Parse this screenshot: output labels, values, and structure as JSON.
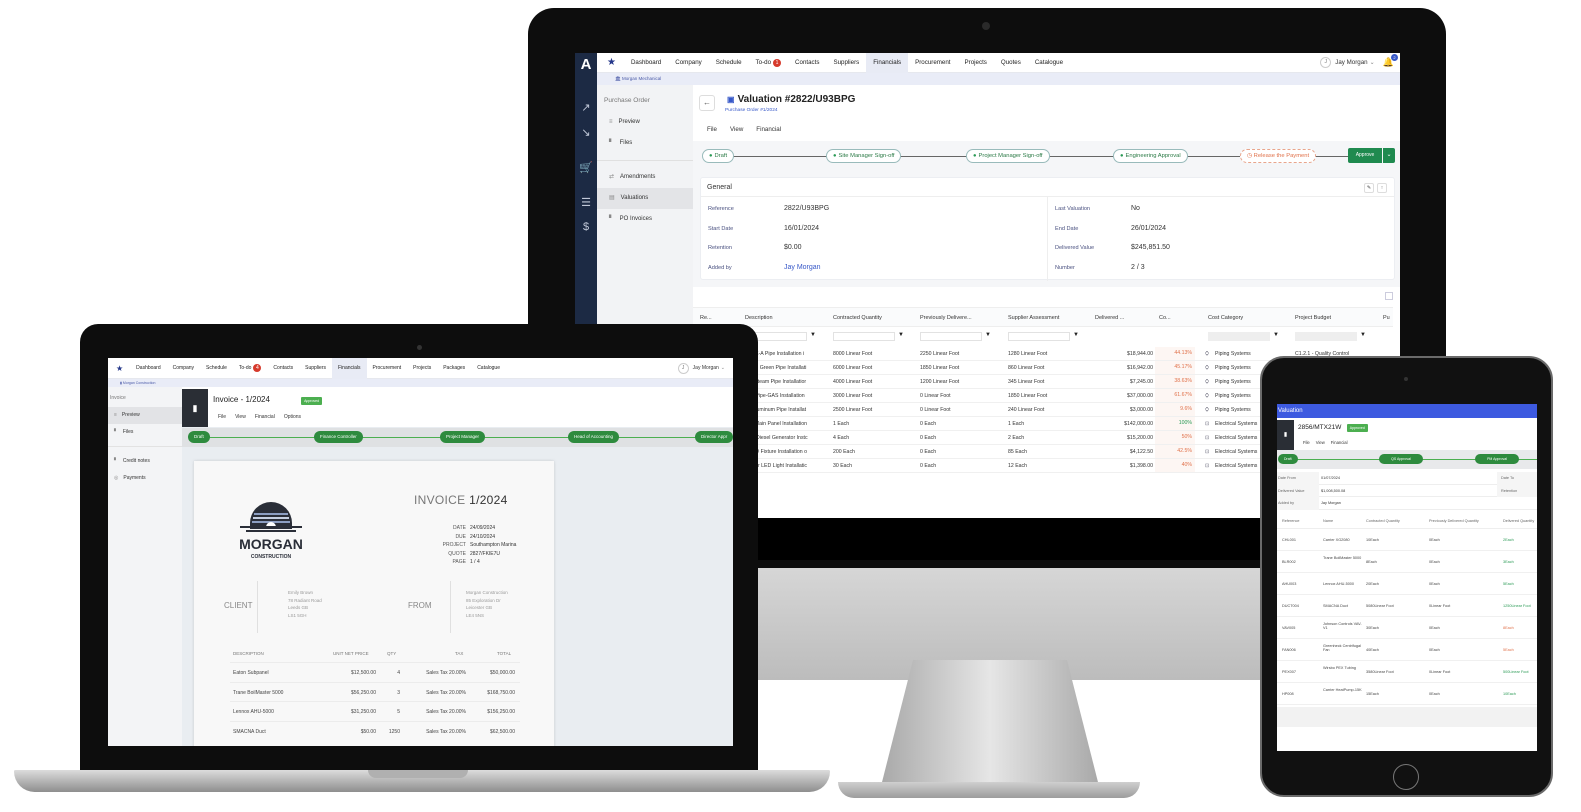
{
  "desktop": {
    "nav": {
      "logo": "A",
      "items": [
        "Dashboard",
        "Company",
        "Schedule",
        "To-do",
        "Contacts",
        "Suppliers",
        "Financials",
        "Procurement",
        "Projects",
        "Quotes",
        "Catalogue"
      ],
      "active": "Financials",
      "todo_badge": "1",
      "user_initial": "J",
      "user_name": "Jay Morgan",
      "notification_badge": "2"
    },
    "org": "Morgan Mechanical",
    "sidebar": {
      "title": "Purchase Order",
      "items": [
        {
          "label": "Preview",
          "icon": "list-icon"
        },
        {
          "label": "Files",
          "icon": "file-icon"
        },
        {
          "label": "Amendments",
          "icon": "swap-icon"
        },
        {
          "label": "Valuations",
          "icon": "table-icon",
          "active": true
        },
        {
          "label": "PO Invoices",
          "icon": "invoice-icon"
        }
      ]
    },
    "header": {
      "title": "Valuation #2822/U93BPG",
      "subtitle": "Purchase Order #1/2024",
      "menus": [
        "File",
        "View",
        "Financial"
      ]
    },
    "workflow": {
      "steps": [
        {
          "label": "Draft",
          "state": "done"
        },
        {
          "label": "Site Manager Sign-off",
          "state": "done"
        },
        {
          "label": "Project Manager Sign-off",
          "state": "done"
        },
        {
          "label": "Engineering Approval",
          "state": "done"
        },
        {
          "label": "Release the Payment",
          "state": "pending"
        }
      ],
      "approve_label": "Approve"
    },
    "general": {
      "title": "General",
      "left": [
        {
          "label": "Reference",
          "value": "2822/U93BPG"
        },
        {
          "label": "Start Date",
          "value": "16/01/2024"
        },
        {
          "label": "Retention",
          "value": "$0.00"
        },
        {
          "label": "Added by",
          "value": "Jay Morgan"
        }
      ],
      "right": [
        {
          "label": "Last Valuation",
          "value": "No"
        },
        {
          "label": "End Date",
          "value": "26/01/2024"
        },
        {
          "label": "Delivered Value",
          "value": "$245,851.50"
        },
        {
          "label": "Number",
          "value": "2 / 3"
        }
      ]
    },
    "grid": {
      "columns": [
        "Re...",
        "Description",
        "Contracted Quantity",
        "Previously Delivere...",
        "Supplier Assessment",
        "Delivered ...",
        "Co...",
        "Cost Category",
        "Project Budget",
        "Pu"
      ],
      "rows": [
        {
          "desc": "r PEX-A Pipe Installation i",
          "contracted": "8000 Linear Foot",
          "prev": "2250 Linear Foot",
          "supplier": "1280 Linear Foot",
          "delivered": "$18,944.00",
          "pct": "44.13%",
          "category": "Piping Systems",
          "budget": "C1.2.1 - Quality Control"
        },
        {
          "desc": "therm Green Pipe Installati",
          "contracted": "6000 Linear Foot",
          "prev": "1850 Linear Foot",
          "supplier": "860 Linear Foot",
          "delivered": "$16,942.00",
          "pct": "45.17%",
          "category": "Piping Systems",
          "budget": ""
        },
        {
          "desc": "ulic Steam Pipe Installatior",
          "contracted": "4000 Linear Foot",
          "prev": "1200 Linear Foot",
          "supplier": "345 Linear Foot",
          "delivered": "$7,245.00",
          "pct": "38.63%",
          "category": "Piping Systems",
          "budget": ""
        },
        {
          "desc": "Iron Pipe-GAS Installation",
          "contracted": "3000 Linear Foot",
          "prev": "0 Linear Foot",
          "supplier": "1850 Linear Foot",
          "delivered": "$37,000.00",
          "pct": "61.67%",
          "category": "Piping Systems",
          "budget": ""
        },
        {
          "desc": "air Aluminum Pipe Installat",
          "contracted": "2500 Linear Foot",
          "prev": "0 Linear Foot",
          "supplier": "240 Linear Foot",
          "delivered": "$3,000.00",
          "pct": "9.6%",
          "category": "Piping Systems",
          "budget": ""
        },
        {
          "desc": "ens Main Panel Installation",
          "contracted": "1 Each",
          "prev": "0 Each",
          "supplier": "1 Each",
          "delivered": "$142,000.00",
          "pct": "100%",
          "category": "Electrical Systems",
          "budget": ""
        },
        {
          "desc": "nins Diesel Generator Instc",
          "contracted": "4 Each",
          "prev": "0 Each",
          "supplier": "2 Each",
          "delivered": "$15,200.00",
          "pct": "50%",
          "category": "Electrical Systems",
          "budget": ""
        },
        {
          "desc": "s LED Fixture Installation o",
          "contracted": "200 Each",
          "prev": "0 Each",
          "supplier": "85 Each",
          "delivered": "$4,122.50",
          "pct": "42.5%",
          "category": "Electrical Systems",
          "budget": ""
        },
        {
          "desc": "utdoor LED Light Installatic",
          "contracted": "30 Each",
          "prev": "0 Each",
          "supplier": "12 Each",
          "delivered": "$1,398.00",
          "pct": "40%",
          "category": "Electrical Systems",
          "budget": ""
        }
      ]
    }
  },
  "laptop": {
    "nav": {
      "items": [
        "Dashboard",
        "Company",
        "Schedule",
        "To-do",
        "Contacts",
        "Suppliers",
        "Financials",
        "Procurement",
        "Projects",
        "Packages",
        "Catalogue"
      ],
      "active": "Financials",
      "todo_badge": "4",
      "user_initial": "J",
      "user_name": "Jay Morgan"
    },
    "org": "Morgan Construction",
    "sidebar": {
      "title": "Invoice",
      "items": [
        {
          "label": "Preview",
          "active": true
        },
        {
          "label": "Files"
        },
        {
          "label": "Credit notes"
        },
        {
          "label": "Payments"
        }
      ]
    },
    "header": {
      "title": "Invoice - 1/2024",
      "status": "Approved",
      "menus": [
        "File",
        "View",
        "Financial",
        "Options"
      ]
    },
    "workflow": [
      "Draft",
      "Finance Controller",
      "Project Manager",
      "Head of Accounting",
      "Director Appr"
    ],
    "invoice": {
      "logo_name": "MORGAN",
      "logo_sub": "CONSTRUCTION",
      "heading": "INVOICE",
      "number": "1/2024",
      "meta": [
        {
          "k": "DATE",
          "v": "24/09/2024"
        },
        {
          "k": "DUE",
          "v": "24/10/2024"
        },
        {
          "k": "PROJECT",
          "v": "Southampton Marina"
        },
        {
          "k": "QUOTE",
          "v": "2827/FKIE7U"
        },
        {
          "k": "PAGE",
          "v": "1 / 4"
        }
      ],
      "client_label": "CLIENT",
      "client": [
        "Emily Brown",
        "78 Radiant Road",
        "Leeds GB",
        "LS1 5GH"
      ],
      "from_label": "FROM",
      "from": [
        "Morgan Construction",
        "85 Exploration Dr",
        "Leicester GB",
        "LE4 5NS"
      ],
      "columns": [
        "DESCRIPTION",
        "UNIT NET PRICE",
        "QTY",
        "TAX",
        "TOTAL"
      ],
      "items": [
        {
          "desc": "Eaton Subpanel",
          "price": "$12,500.00",
          "qty": "4",
          "tax": "Sales Tax 20.00%",
          "total": "$50,000.00"
        },
        {
          "desc": "Trane BoilMaster 5000",
          "price": "$56,250.00",
          "qty": "3",
          "tax": "Sales Tax 20.00%",
          "total": "$168,750.00"
        },
        {
          "desc": "Lennox AHU-5000",
          "price": "$31,250.00",
          "qty": "5",
          "tax": "Sales Tax 20.00%",
          "total": "$156,250.00"
        },
        {
          "desc": "SMACNA Duct",
          "price": "$50.00",
          "qty": "1250",
          "tax": "Sales Tax 20.00%",
          "total": "$62,500.00"
        }
      ]
    }
  },
  "tablet": {
    "top": "Valuation",
    "title": "2856/MTX21W",
    "status": "Approved",
    "menus": [
      "File",
      "View",
      "Financial"
    ],
    "workflow": [
      "Draft",
      "QS Approval",
      "PM Approval"
    ],
    "info": [
      {
        "label": "Date From",
        "value": "01/07/2024",
        "label2": "Date To"
      },
      {
        "label": "Delivered Value",
        "value": "$1,008,500.08",
        "label2": "Retention"
      },
      {
        "label": "Added by",
        "value": "Jay Morgan",
        "label2": ""
      }
    ],
    "columns": [
      "Reference",
      "Name",
      "Contracted Quantity",
      "Previously Delivered Quantity",
      "Delivered Quantity"
    ],
    "rows": [
      {
        "ref": "CHL001",
        "name": "Carrier XG2080",
        "contracted": "10Each",
        "prev": "0Each",
        "delivered": "2Each",
        "tone": "g"
      },
      {
        "ref": "BLR002",
        "name": "Trane BoilMaster 5000",
        "contracted": "8Each",
        "prev": "0Each",
        "delivered": "3Each",
        "tone": "g"
      },
      {
        "ref": "AHU003",
        "name": "Lennox AHU-5000",
        "contracted": "20Each",
        "prev": "0Each",
        "delivered": "5Each",
        "tone": "g"
      },
      {
        "ref": "DUCT004",
        "name": "SMACNA Duct",
        "contracted": "5080Linear Foot",
        "prev": "0Linear Foot",
        "delivered": "1250Linear Foot",
        "tone": "g"
      },
      {
        "ref": "VAV005",
        "name": "Johnson Controls VAV-V1",
        "contracted": "30Each",
        "prev": "0Each",
        "delivered": "8Each",
        "tone": "o"
      },
      {
        "ref": "FAN006",
        "name": "Greenheck Centrifugal Fan",
        "contracted": "40Each",
        "prev": "0Each",
        "delivered": "5Each",
        "tone": "o"
      },
      {
        "ref": "PEX007",
        "name": "Wirsbo PEX Tubing",
        "contracted": "3580Linear Foot",
        "prev": "0Linear Foot",
        "delivered": "500Linear Foot",
        "tone": "g"
      },
      {
        "ref": "HP008",
        "name": "Carrier HeatPump-15K",
        "contracted": "15Each",
        "prev": "0Each",
        "delivered": "10Each",
        "tone": "g"
      }
    ]
  }
}
